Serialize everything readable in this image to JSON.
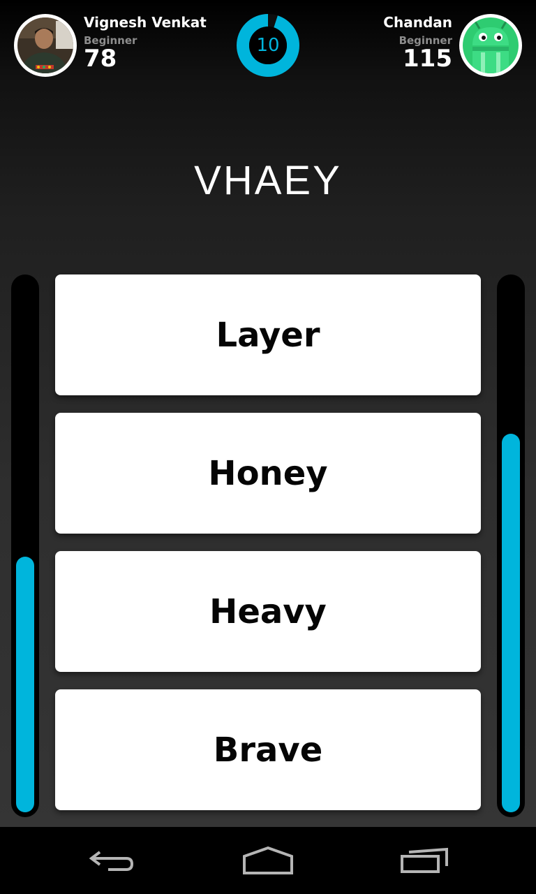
{
  "players": {
    "left": {
      "name": "Vignesh Venkat",
      "level": "Beginner",
      "score": "78",
      "progress": 0.48
    },
    "right": {
      "name": "Chandan",
      "level": "Beginner",
      "score": "115",
      "progress": 0.71
    }
  },
  "timer": {
    "value": "10",
    "remaining_fraction": 0.95
  },
  "question": {
    "word": "VHAEY"
  },
  "options": [
    {
      "label": "Layer"
    },
    {
      "label": "Honey"
    },
    {
      "label": "Heavy"
    },
    {
      "label": "Brave"
    }
  ],
  "colors": {
    "accent": "#00b5dc",
    "card": "#ffffff",
    "background_top": "#000000",
    "background_bottom": "#353535"
  },
  "navbar": {
    "icons": [
      "back-icon",
      "home-icon",
      "recent-apps-icon"
    ]
  }
}
